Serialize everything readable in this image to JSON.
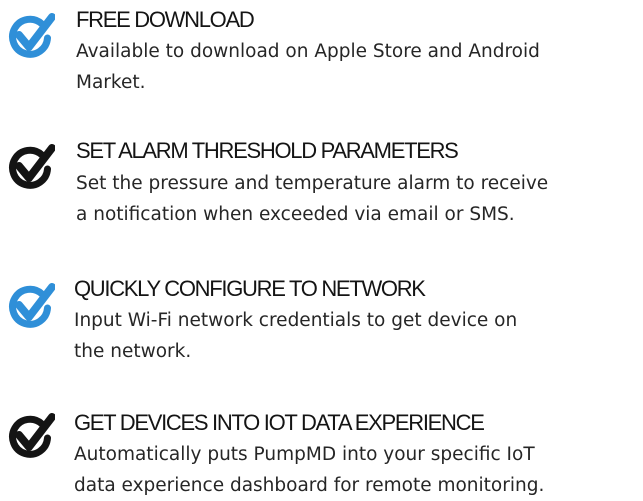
{
  "colors": {
    "accent_blue": "#2f8fd8",
    "accent_dark": "#141414",
    "text": "#262626"
  },
  "features": [
    {
      "icon": "check-circle-icon",
      "icon_color": "#2f8fd8",
      "title": "FREE DOWNLOAD",
      "description_lines": [
        "Available to download on Apple Store and Android",
        "Market."
      ]
    },
    {
      "icon": "check-circle-icon",
      "icon_color": "#141414",
      "title": "SET ALARM THRESHOLD PARAMETERS",
      "description_lines": [
        "Set the pressure and temperature alarm to receive",
        "a notification when exceeded via email or SMS."
      ]
    },
    {
      "icon": "check-circle-icon",
      "icon_color": "#2f8fd8",
      "title": "QUICKLY CONFIGURE TO NETWORK",
      "description_lines": [
        "Input Wi-Fi network credentials to get device on",
        "the network."
      ]
    },
    {
      "icon": "check-circle-icon",
      "icon_color": "#141414",
      "title": "GET DEVICES INTO IOT DATA EXPERIENCE",
      "description_lines": [
        "Automatically puts PumpMD into your specific IoT",
        "data experience dashboard for remote monitoring."
      ]
    }
  ]
}
